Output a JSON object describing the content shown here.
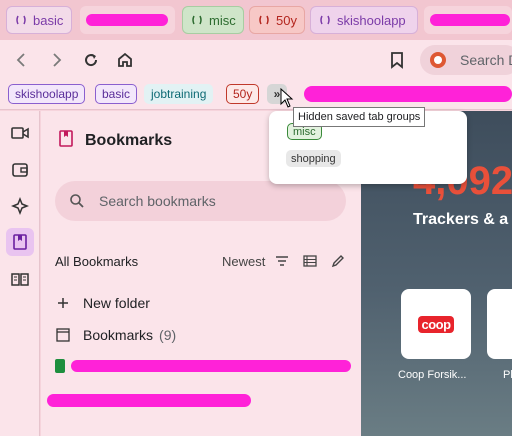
{
  "tabs": [
    {
      "label": "basic",
      "color": "#7b3ba8"
    },
    {
      "label": "misc",
      "color": "#2c6b2f"
    },
    {
      "label": "50y",
      "color": "#b3261e"
    },
    {
      "label": "skishoolapp",
      "color": "#7b3ba8"
    }
  ],
  "toolbar": {
    "back_icon": "back-arrow-icon",
    "forward_icon": "forward-arrow-icon",
    "reload_icon": "reload-icon",
    "home_icon": "home-icon",
    "bookmark_icon": "bookmark-icon",
    "omnibox_text": "Search D"
  },
  "bookmarks_bar": {
    "groups": [
      "skishoolapp",
      "basic",
      "jobtraining",
      "50y"
    ],
    "more_button": "»"
  },
  "tooltip": "Hidden saved tab groups",
  "hidden_groups": [
    "misc",
    "shopping"
  ],
  "panel": {
    "title": "Bookmarks",
    "search_placeholder": "Search bookmarks",
    "section_title": "All Bookmarks",
    "sort_label": "Newest",
    "new_folder_label": "New folder",
    "folder_label": "Bookmarks",
    "folder_count": "(9)"
  },
  "ntp": {
    "counter": "4,092",
    "trackers_text": "Trackers & a",
    "tiles": [
      {
        "label": "Coop Forsik...",
        "logo": "coop"
      },
      {
        "label": "Pl"
      }
    ]
  },
  "colors": {
    "accent": "#ff22d8",
    "counter": "#e9503a",
    "background": "#f6d4dc"
  }
}
